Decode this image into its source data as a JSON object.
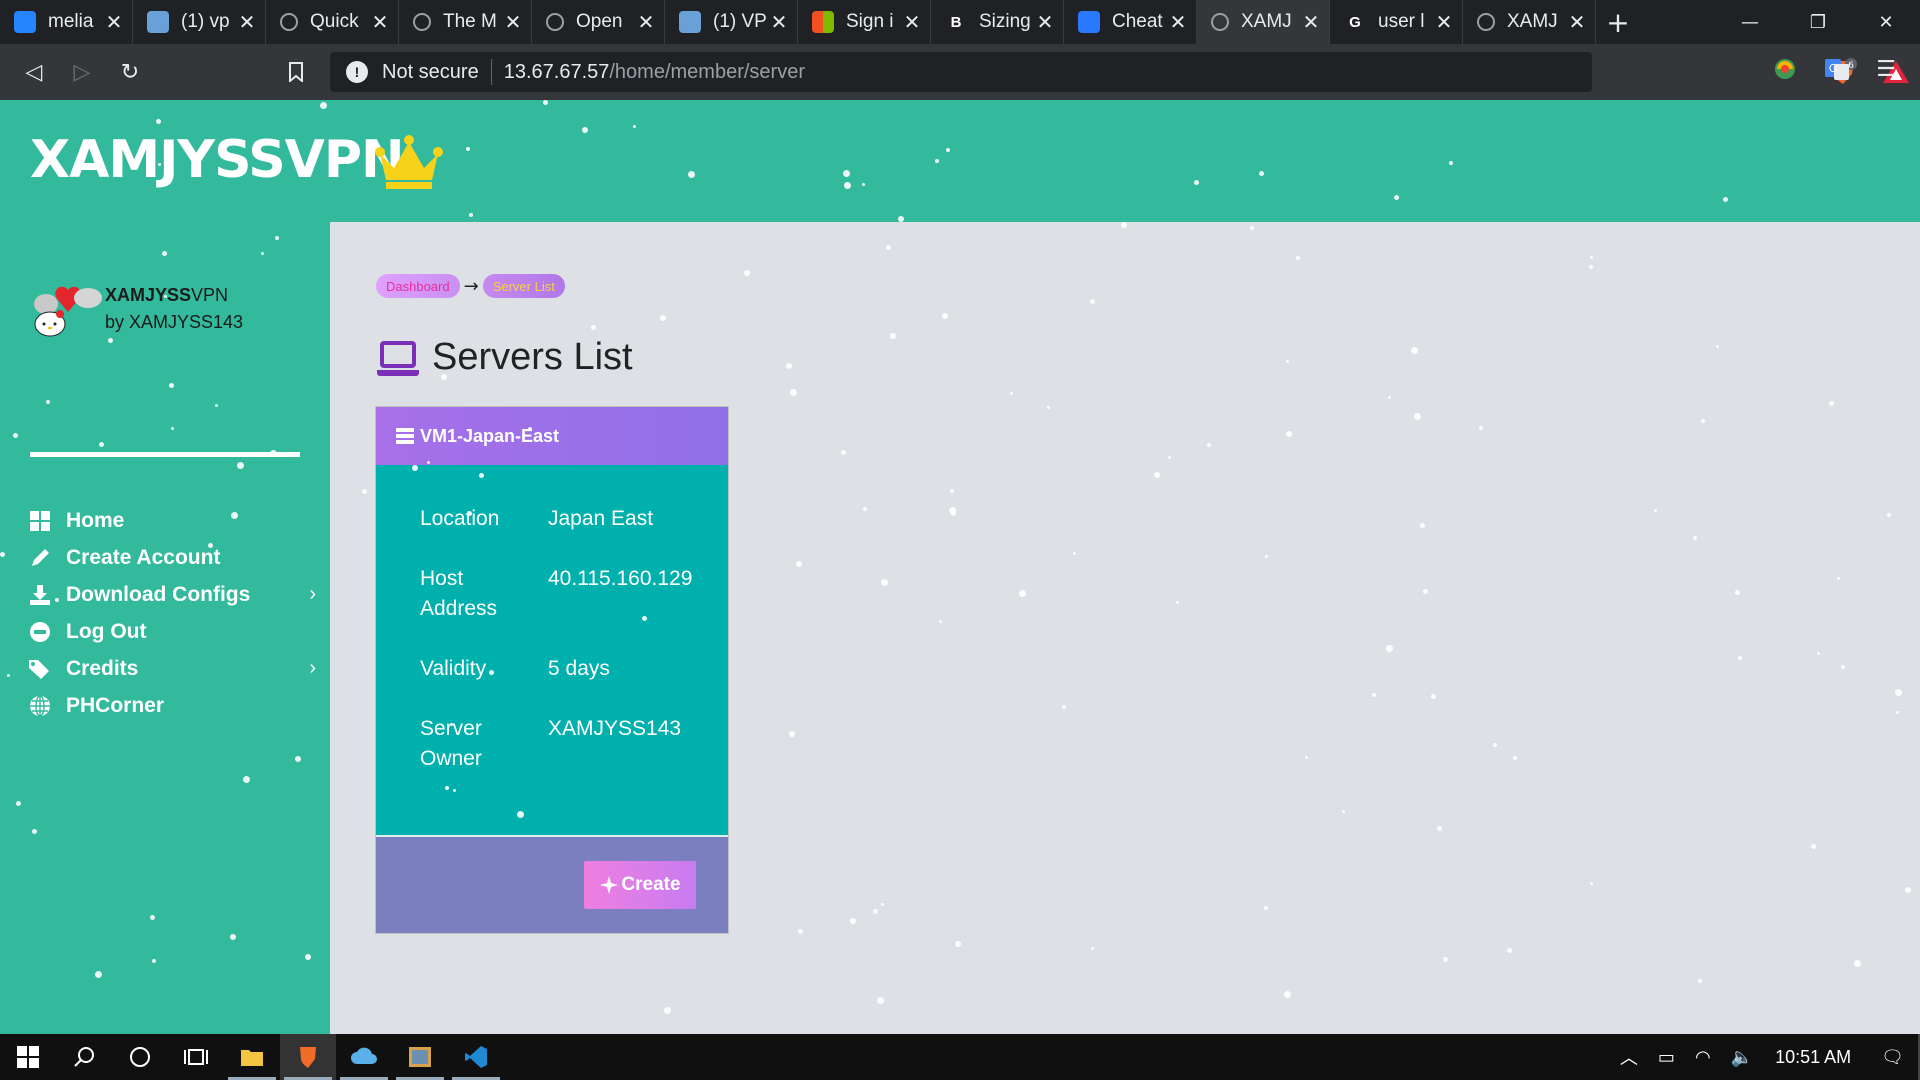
{
  "browser": {
    "tabs": [
      {
        "title": "melia",
        "favicon": "atlassian-icon",
        "color": "#2684ff"
      },
      {
        "title": "(1) vp",
        "favicon": "virtualbox-icon",
        "color": "#6aa0d8"
      },
      {
        "title": "Quick",
        "favicon": "globe-icon",
        "color": "#9aa0a6"
      },
      {
        "title": "The M",
        "favicon": "globe-icon",
        "color": "#9aa0a6"
      },
      {
        "title": "Open",
        "favicon": "globe-icon",
        "color": "#9aa0a6"
      },
      {
        "title": "(1) VP",
        "favicon": "virtualbox-icon",
        "color": "#6aa0d8"
      },
      {
        "title": "Sign i",
        "favicon": "microsoft-icon",
        "color": "#f25022"
      },
      {
        "title": "Sizing",
        "favicon": "bootstrap-icon",
        "letter": "B",
        "color": "#ffffff"
      },
      {
        "title": "Cheat",
        "favicon": "flag-icon",
        "color": "#2979ff"
      },
      {
        "title": "XAMJ",
        "favicon": "globe-icon",
        "color": "#9aa0a6",
        "active": true
      },
      {
        "title": "user l",
        "favicon": "google-icon",
        "letter": "G",
        "color": "#ffffff"
      },
      {
        "title": "XAMJ",
        "favicon": "globe-icon",
        "color": "#9aa0a6"
      }
    ],
    "new_tab": "+",
    "window_controls": {
      "minimize": "—",
      "restore": "❐",
      "close": "✕"
    },
    "nav": {
      "back": "◁",
      "forward": "▷",
      "reload": "↻",
      "bookmark": "🔖"
    },
    "omnibox": {
      "security_label": "Not secure",
      "host": "13.67.67.57",
      "path": "/home/member/server"
    },
    "brave_badge": "6",
    "extensions": [
      "extension-icon",
      "translate-icon"
    ],
    "menu": "☰"
  },
  "site": {
    "brand": "XAMJYSSVPN",
    "crown_color": "#f7d21a",
    "accent": "#33b99b"
  },
  "sidebar": {
    "user_name_bold": "XAMJYSS",
    "user_name_rest": "VPN",
    "user_by": "by XAMJYSS143",
    "items": [
      {
        "label": "Home",
        "icon": "windows-icon",
        "has_children": false
      },
      {
        "label": "Create Account",
        "icon": "pencil-icon",
        "has_children": false
      },
      {
        "label": "Download Configs",
        "icon": "download-icon",
        "has_children": true
      },
      {
        "label": "Log Out",
        "icon": "minus-circle-icon",
        "has_children": false
      },
      {
        "label": "Credits",
        "icon": "tags-icon",
        "has_children": true
      },
      {
        "label": "PHCorner",
        "icon": "globe-icon",
        "has_children": false
      }
    ]
  },
  "main": {
    "breadcrumb": [
      "Dashboard",
      "Server List"
    ],
    "breadcrumb_sep": "→",
    "title": "Servers List",
    "card": {
      "header": "VM1-Japan-East",
      "rows": [
        {
          "label": "Location",
          "value": "Japan East"
        },
        {
          "label": "Host Address",
          "value": "40.115.160.129"
        },
        {
          "label": "Validity",
          "value": "5 days"
        },
        {
          "label": "Server Owner",
          "value": "XAMJYSS143"
        }
      ],
      "button": "Create"
    }
  },
  "taskbar": {
    "apps": [
      "windows-start-icon",
      "search-icon",
      "cortana-icon",
      "task-view-icon",
      "file-explorer-icon",
      "brave-icon",
      "cloud-app-icon",
      "photo-app-icon",
      "vscode-icon"
    ],
    "time": "10:51 AM"
  }
}
